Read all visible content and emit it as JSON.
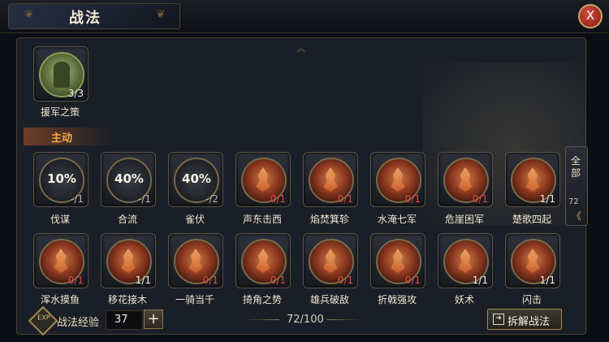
{
  "header": {
    "title": "战法",
    "close_label": "X"
  },
  "equipped": {
    "name": "援军之策",
    "count": "3/3"
  },
  "section_label": "主动",
  "side_tab": {
    "label": "全部",
    "count": "72",
    "chevron": "《"
  },
  "row1": [
    {
      "name": "伐谋",
      "pct": "10%",
      "count": "-/1",
      "style": "gray"
    },
    {
      "name": "合流",
      "pct": "40%",
      "count": "-/1",
      "style": "gray"
    },
    {
      "name": "雀伏",
      "pct": "40%",
      "count": "-/2",
      "style": "gray"
    },
    {
      "name": "声东击西",
      "count": "0/1",
      "style": "red"
    },
    {
      "name": "焰焚箕轸",
      "count": "0/1",
      "style": "red"
    },
    {
      "name": "水淹七军",
      "count": "0/1",
      "style": "red"
    },
    {
      "name": "危崖困军",
      "count": "0/1",
      "style": "red"
    },
    {
      "name": "楚歌四起",
      "count": "1/1",
      "style": "white"
    }
  ],
  "row2": [
    {
      "name": "浑水摸鱼",
      "count": "0/1",
      "style": "red"
    },
    {
      "name": "移花接木",
      "count": "1/1",
      "style": "white"
    },
    {
      "name": "一骑当千",
      "count": "0/1",
      "style": "red"
    },
    {
      "name": "掎角之势",
      "count": "0/1",
      "style": "red"
    },
    {
      "name": "雄兵破敌",
      "count": "0/1",
      "style": "red"
    },
    {
      "name": "折戟强攻",
      "count": "0/1",
      "style": "red"
    },
    {
      "name": "妖术",
      "count": "1/1",
      "style": "white"
    },
    {
      "name": "闪击",
      "count": "1/1",
      "style": "white"
    }
  ],
  "footer": {
    "exp_label": "战法经验",
    "exp_value": "37",
    "plus_label": "+",
    "count": "72/100",
    "decompose_label": "拆解战法"
  }
}
